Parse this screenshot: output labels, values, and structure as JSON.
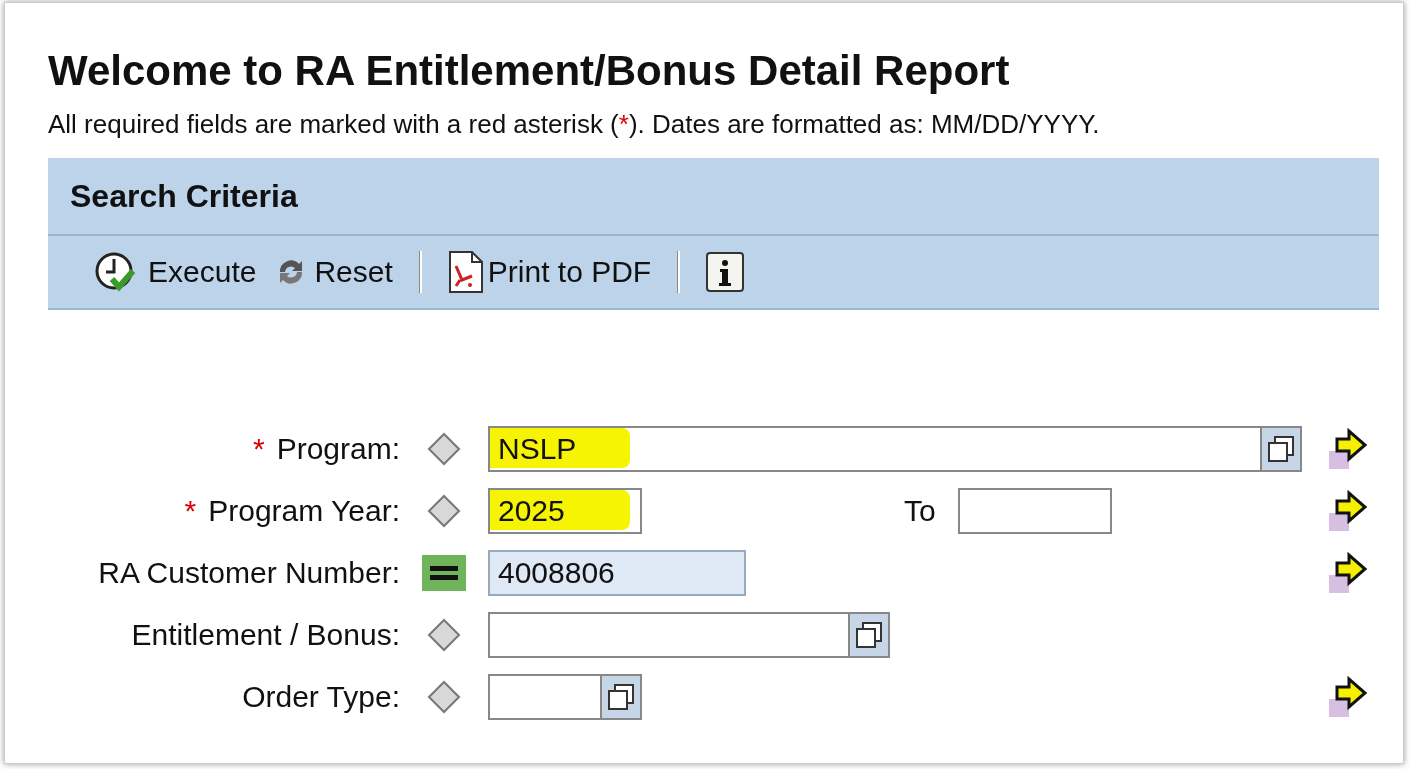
{
  "title": "Welcome to RA Entitlement/Bonus Detail Report",
  "intro": {
    "before": "All required fields are marked with a red asterisk (",
    "mark": "*",
    "after": "). Dates are formatted as: MM/DD/YYYY."
  },
  "panel": {
    "title": "Search Criteria",
    "toolbar": [
      {
        "kind": "execute",
        "label": "Execute"
      },
      {
        "kind": "reset",
        "label": "Reset"
      },
      {
        "kind": "separator"
      },
      {
        "kind": "pdf",
        "label": "Print to PDF"
      },
      {
        "kind": "separator"
      },
      {
        "kind": "info"
      }
    ]
  },
  "fields": [
    {
      "label": "Program:",
      "required_mark": "*",
      "kind": "diamond",
      "value": "NSLP",
      "value_help": true,
      "highlighted": true,
      "multiple": true
    },
    {
      "label": "Program Year:",
      "required_mark": "*",
      "kind": "diamond",
      "value": "2025",
      "value_help": false,
      "highlighted": true,
      "to_label": "To",
      "multiple": true
    },
    {
      "label": "RA Customer Number:",
      "kind": "equal",
      "value": "4008806",
      "value_help": false,
      "highlighted": false,
      "multiple": true
    },
    {
      "label": "Entitlement / Bonus:",
      "kind": "diamond",
      "value_help": true,
      "highlighted": false,
      "multiple": false
    },
    {
      "label": "Order Type:",
      "kind": "diamond",
      "value_help": true,
      "highlighted": false,
      "multiple": true
    }
  ]
}
